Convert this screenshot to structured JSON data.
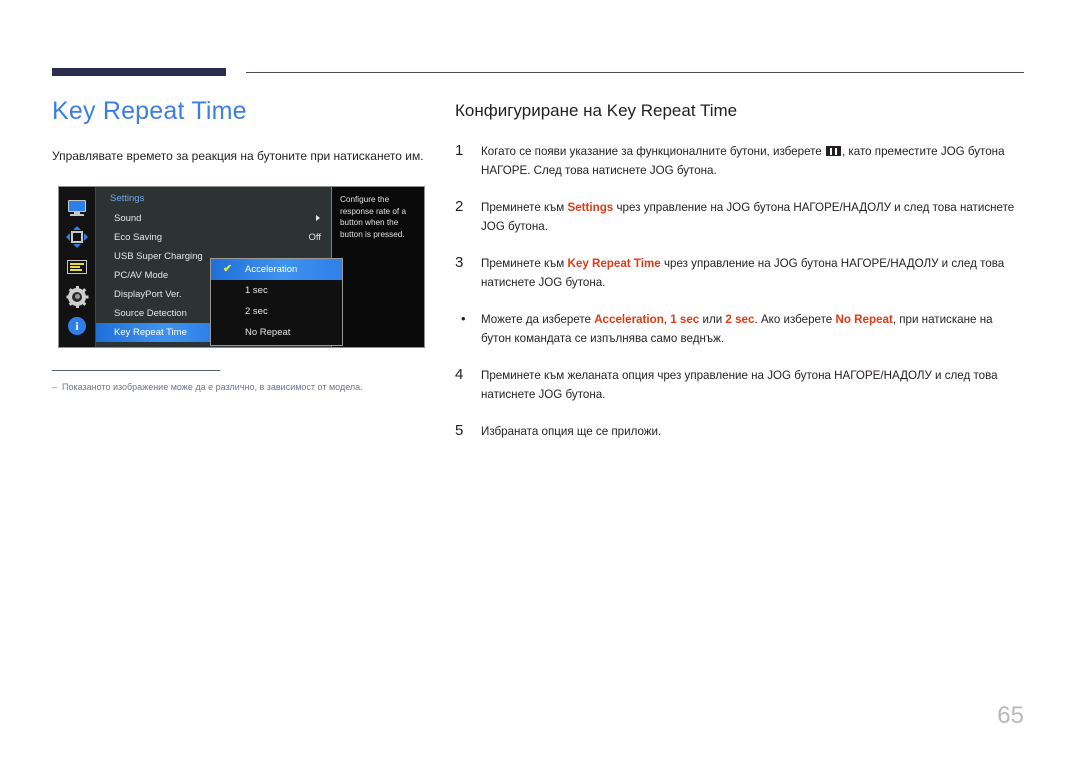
{
  "document": {
    "page_number": "65"
  },
  "left": {
    "title": "Key Repeat Time",
    "description": "Управлявате времето за реакция на бутоните при натискането им.",
    "footnote_dash": "‒",
    "footnote": "Показаното изображение може да е различно, в зависимост от модела."
  },
  "osd": {
    "sidebar_icons": [
      "monitor-icon",
      "four-way-arrows-icon",
      "list-lines-icon",
      "gear-icon",
      "info-icon"
    ],
    "info_glyph": "i",
    "menu_title": "Settings",
    "rows": [
      {
        "label": "Sound",
        "value": "",
        "has_arrow": true,
        "selected": false
      },
      {
        "label": "Eco Saving",
        "value": "Off",
        "has_arrow": false,
        "selected": false
      },
      {
        "label": "USB Super Charging",
        "value": "",
        "has_arrow": false,
        "selected": false
      },
      {
        "label": "PC/AV Mode",
        "value": "",
        "has_arrow": false,
        "selected": false
      },
      {
        "label": "DisplayPort Ver.",
        "value": "",
        "has_arrow": false,
        "selected": false
      },
      {
        "label": "Source Detection",
        "value": "",
        "has_arrow": false,
        "selected": false
      },
      {
        "label": "Key Repeat Time",
        "value": "",
        "has_arrow": false,
        "selected": true
      }
    ],
    "dropdown": {
      "check_glyph": "✔",
      "items": [
        {
          "label": "Acceleration",
          "active": true
        },
        {
          "label": "1 sec",
          "active": false
        },
        {
          "label": "2 sec",
          "active": false
        },
        {
          "label": "No Repeat",
          "active": false
        }
      ]
    },
    "help_text": "Configure the response rate of a button when the button is pressed."
  },
  "right": {
    "section_title": "Конфигуриране на Key Repeat Time",
    "steps": [
      {
        "marker": "1",
        "type": "number",
        "parts": [
          {
            "t": "Когато се появи указание за функционалните бутони, изберете ",
            "hl": false
          },
          {
            "t": "[menu-icon]",
            "hl": false,
            "icon": true
          },
          {
            "t": ", като преместите JOG бутона НАГОРЕ. След това натиснете JOG бутона.",
            "hl": false
          }
        ]
      },
      {
        "marker": "2",
        "type": "number",
        "parts": [
          {
            "t": "Преминете към ",
            "hl": false
          },
          {
            "t": "Settings",
            "hl": true
          },
          {
            "t": " чрез управление на JOG бутона НАГОРЕ/НАДОЛУ и след това натиснете JOG бутона.",
            "hl": false
          }
        ]
      },
      {
        "marker": "3",
        "type": "number",
        "parts": [
          {
            "t": "Преминете към ",
            "hl": false
          },
          {
            "t": "Key Repeat Time",
            "hl": true
          },
          {
            "t": " чрез управление на JOG бутона НАГОРЕ/НАДОЛУ и след това натиснете JOG бутона.",
            "hl": false
          }
        ]
      },
      {
        "marker": "•",
        "type": "bullet",
        "parts": [
          {
            "t": "Можете да изберете ",
            "hl": false
          },
          {
            "t": "Acceleration",
            "hl": true
          },
          {
            "t": ", ",
            "hl": false
          },
          {
            "t": "1 sec",
            "hl": true
          },
          {
            "t": " или ",
            "hl": false
          },
          {
            "t": "2 sec",
            "hl": true
          },
          {
            "t": ". Ако изберете ",
            "hl": false
          },
          {
            "t": "No Repeat",
            "hl": true
          },
          {
            "t": ", при натискане на бутон командата се изпълнява само веднъж.",
            "hl": false
          }
        ]
      },
      {
        "marker": "4",
        "type": "number",
        "parts": [
          {
            "t": "Преминете към желаната опция чрез управление на JOG бутона НАГОРЕ/НАДОЛУ и след това натиснете JOG бутона.",
            "hl": false
          }
        ]
      },
      {
        "marker": "5",
        "type": "number",
        "parts": [
          {
            "t": "Избраната опция ще се приложи.",
            "hl": false
          }
        ]
      }
    ]
  },
  "colors": {
    "title_blue": "#3d7fe0",
    "highlight_red": "#e03a14",
    "header_bar": "#2e2d4d",
    "footnote": "#6e7390",
    "osd_accent": "#2f7fe8"
  }
}
